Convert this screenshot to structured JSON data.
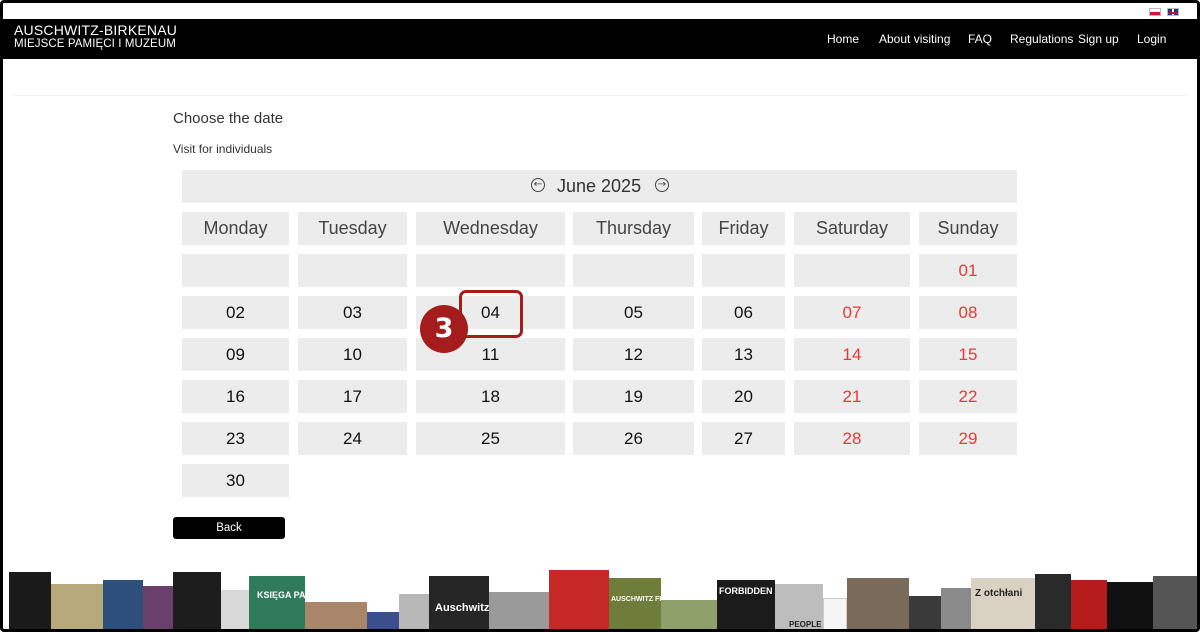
{
  "header": {
    "brand_line1": "AUSCHWITZ-BIRKENAU",
    "brand_line2": "MIEJSCE PAMIĘCI I MUZEUM",
    "nav": [
      "Home",
      "About visiting",
      "FAQ",
      "Regulations",
      "Sign up",
      "Login"
    ]
  },
  "languages": [
    "polish-flag-icon",
    "english-flag-icon"
  ],
  "page": {
    "title": "Choose the date",
    "subtitle": "Visit for individuals"
  },
  "calendar": {
    "month_label": "June 2025",
    "weekdays": [
      "Monday",
      "Tuesday",
      "Wednesday",
      "Thursday",
      "Friday",
      "Saturday",
      "Sunday"
    ],
    "weeks": [
      [
        "",
        "",
        "",
        "",
        "",
        "",
        "01"
      ],
      [
        "02",
        "03",
        "04",
        "05",
        "06",
        "07",
        "08"
      ],
      [
        "09",
        "10",
        "11",
        "12",
        "13",
        "14",
        "15"
      ],
      [
        "16",
        "17",
        "18",
        "19",
        "20",
        "21",
        "22"
      ],
      [
        "23",
        "24",
        "25",
        "26",
        "27",
        "28",
        "29"
      ],
      [
        "30"
      ]
    ],
    "weekend_color": "#e53935",
    "highlighted_day": "04"
  },
  "annotation": {
    "step_number": "3",
    "color": "#a51c1c"
  },
  "actions": {
    "back_label": "Back"
  },
  "footer_books": {
    "titles": [
      "Auschwitz",
      "KSIĘGA PAMIĘCI",
      "AUSCHWITZ FROM A TO Z",
      "FORBIDDEN ART",
      "PEOPLE",
      "Z otchłani"
    ]
  }
}
